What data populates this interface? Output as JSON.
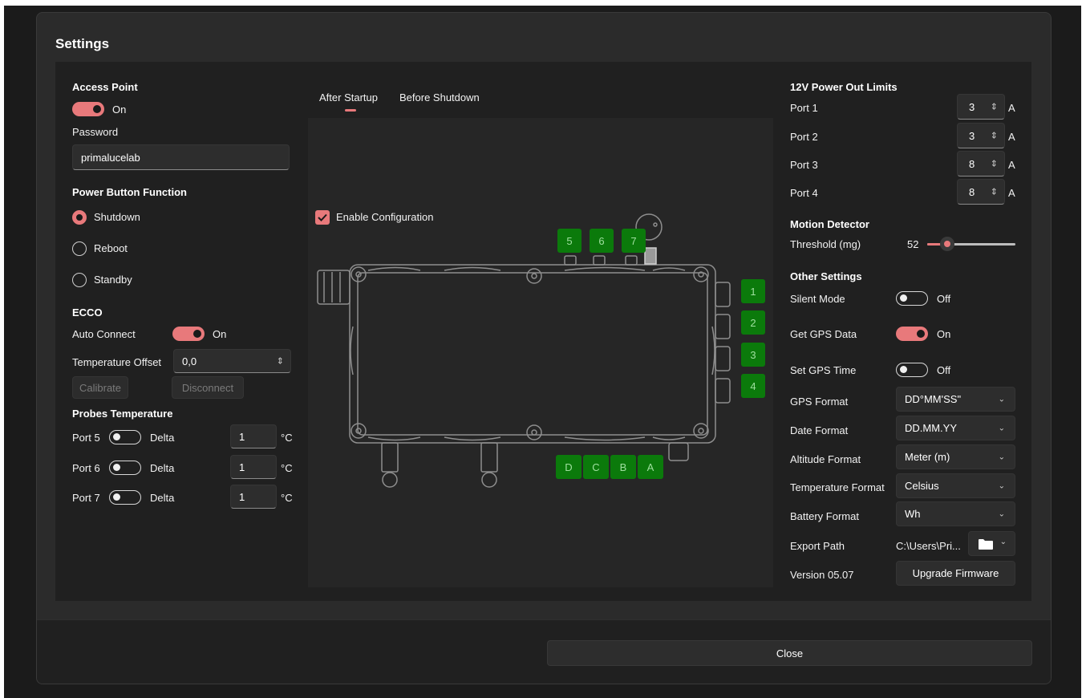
{
  "dialog": {
    "title": "Settings",
    "close_label": "Close"
  },
  "access_point": {
    "heading": "Access Point",
    "toggle_label": "On",
    "password_label": "Password",
    "password_value": "primalucelab"
  },
  "power_button": {
    "heading": "Power Button Function",
    "options": [
      {
        "label": "Shutdown",
        "selected": true
      },
      {
        "label": "Reboot",
        "selected": false
      },
      {
        "label": "Standby",
        "selected": false
      }
    ]
  },
  "ecco": {
    "heading": "ECCO",
    "auto_connect_label": "Auto Connect",
    "auto_connect_state": "On",
    "temp_offset_label": "Temperature Offset",
    "temp_offset_value": "0,0",
    "calibrate_label": "Calibrate",
    "disconnect_label": "Disconnect"
  },
  "probes": {
    "heading": "Probes Temperature",
    "rows": [
      {
        "port": "Port 5",
        "mode": "Delta",
        "value": "1",
        "unit": "°C"
      },
      {
        "port": "Port 6",
        "mode": "Delta",
        "value": "1",
        "unit": "°C"
      },
      {
        "port": "Port 7",
        "mode": "Delta",
        "value": "1",
        "unit": "°C"
      }
    ]
  },
  "config": {
    "tabs": [
      "After Startup",
      "Before Shutdown"
    ],
    "enable_label": "Enable Configuration",
    "top_ports": [
      "5",
      "6",
      "7"
    ],
    "right_ports": [
      "1",
      "2",
      "3",
      "4"
    ],
    "bottom_ports": [
      "D",
      "C",
      "B",
      "A"
    ]
  },
  "power_limits": {
    "heading": "12V Power Out Limits",
    "unit": "A",
    "ports": [
      {
        "label": "Port 1",
        "value": "3"
      },
      {
        "label": "Port 2",
        "value": "3"
      },
      {
        "label": "Port 3",
        "value": "8"
      },
      {
        "label": "Port 4",
        "value": "8"
      }
    ]
  },
  "motion": {
    "heading": "Motion Detector",
    "threshold_label": "Threshold (mg)",
    "threshold_value": "52"
  },
  "other": {
    "heading": "Other Settings",
    "silent_label": "Silent Mode",
    "silent_state": "Off",
    "gps_data_label": "Get GPS Data",
    "gps_data_state": "On",
    "gps_time_label": "Set GPS Time",
    "gps_time_state": "Off",
    "gps_format_label": "GPS Format",
    "gps_format_value": "DD°MM'SS\"",
    "date_format_label": "Date Format",
    "date_format_value": "DD.MM.YY",
    "altitude_format_label": "Altitude Format",
    "altitude_format_value": "Meter (m)",
    "temp_format_label": "Temperature Format",
    "temp_format_value": "Celsius",
    "battery_format_label": "Battery Format",
    "battery_format_value": "Wh",
    "export_path_label": "Export Path",
    "export_path_value": "C:\\Users\\Pri...",
    "version_label": "Version 05.07",
    "upgrade_label": "Upgrade Firmware"
  },
  "colors": {
    "accent": "#e8797b",
    "port_green": "#0b7a0b",
    "panel": "#202020"
  }
}
